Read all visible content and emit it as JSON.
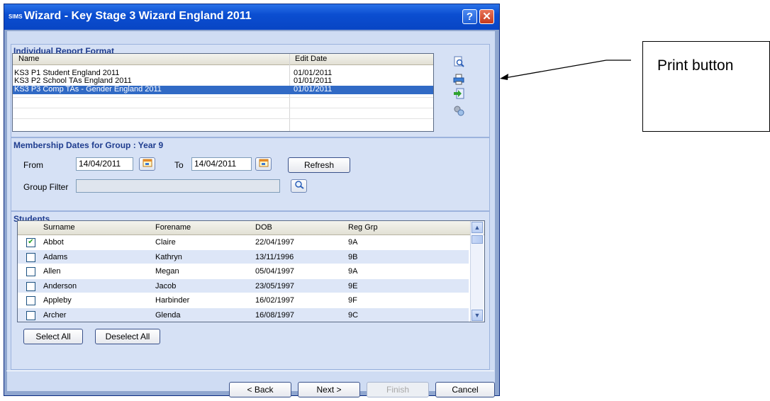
{
  "window": {
    "logo": "SIMS",
    "title": "Wizard - Key Stage 3 Wizard England 2011",
    "help_label": "?",
    "close_label": "✕"
  },
  "report_format": {
    "title": "Individual Report Format",
    "columns": [
      "Name",
      "Edit Date"
    ],
    "rows": [
      {
        "name": "KS3 P1 Student England 2011",
        "date": "01/01/2011",
        "selected": false
      },
      {
        "name": "KS3 P2 School TAs England 2011",
        "date": "01/01/2011",
        "selected": false
      },
      {
        "name": "KS3 P3 Comp TAs - Gender England 2011",
        "date": "01/01/2011",
        "selected": true
      }
    ],
    "side_icons": [
      "preview-icon",
      "print-icon",
      "export-icon",
      "settings-icon"
    ]
  },
  "membership": {
    "title": "Membership Dates for Group : Year 9",
    "from_label": "From",
    "from_value": "14/04/2011",
    "to_label": "To",
    "to_value": "14/04/2011",
    "refresh_label": "Refresh",
    "group_filter_label": "Group Filter",
    "group_filter_value": ""
  },
  "students": {
    "title": "Students",
    "columns": [
      "Surname",
      "Forename",
      "DOB",
      "Reg Grp"
    ],
    "rows": [
      {
        "surname": "Abbot",
        "forename": "Claire",
        "dob": "22/04/1997",
        "reg": "9A",
        "checked": true
      },
      {
        "surname": "Adams",
        "forename": "Kathryn",
        "dob": "13/11/1996",
        "reg": "9B",
        "checked": false
      },
      {
        "surname": "Allen",
        "forename": "Megan",
        "dob": "05/04/1997",
        "reg": "9A",
        "checked": false
      },
      {
        "surname": "Anderson",
        "forename": "Jacob",
        "dob": "23/05/1997",
        "reg": "9E",
        "checked": false
      },
      {
        "surname": "Appleby",
        "forename": "Harbinder",
        "dob": "16/02/1997",
        "reg": "9F",
        "checked": false
      },
      {
        "surname": "Archer",
        "forename": "Glenda",
        "dob": "16/08/1997",
        "reg": "9C",
        "checked": false
      }
    ],
    "select_all_label": "Select All",
    "deselect_all_label": "Deselect All"
  },
  "buttons": {
    "back": "< Back",
    "next": "Next >",
    "finish": "Finish",
    "cancel": "Cancel"
  },
  "annotation": {
    "text": "Print button"
  },
  "colors": {
    "title_bar": "#0b4ed1",
    "selection": "#316ac5",
    "panel_title": "#1f3d8f"
  }
}
